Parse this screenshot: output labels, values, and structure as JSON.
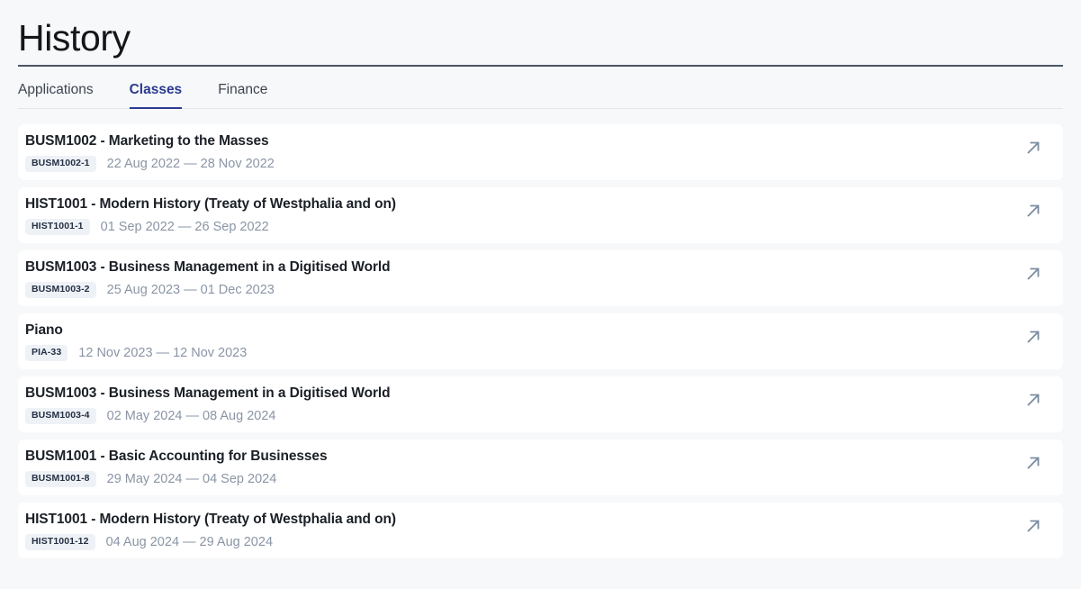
{
  "header": {
    "title": "History"
  },
  "tabs": [
    {
      "label": "Applications",
      "active": false
    },
    {
      "label": "Classes",
      "active": true
    },
    {
      "label": "Finance",
      "active": false
    }
  ],
  "icons": {
    "open_external": "arrow-up-right-icon"
  },
  "colors": {
    "page_background": "#f7f8fa",
    "card_background": "#ffffff",
    "accent": "#2b3a8f",
    "title_text": "#14161a",
    "badge_background": "#eef2f7",
    "badge_text": "#253043",
    "date_text": "#8a95a5",
    "arrow": "#7b8ca0",
    "rule": "#4a5568"
  },
  "classes": [
    {
      "title": "BUSM1002 - Marketing to the Masses",
      "code": "BUSM1002-1",
      "dates": "22 Aug 2022 — 28 Nov 2022"
    },
    {
      "title": "HIST1001 - Modern History (Treaty of Westphalia and on)",
      "code": "HIST1001-1",
      "dates": "01 Sep 2022 — 26 Sep 2022"
    },
    {
      "title": "BUSM1003 - Business Management in a Digitised World",
      "code": "BUSM1003-2",
      "dates": "25 Aug 2023 — 01 Dec 2023"
    },
    {
      "title": "Piano",
      "code": "PIA-33",
      "dates": "12 Nov 2023 — 12 Nov 2023"
    },
    {
      "title": "BUSM1003 - Business Management in a Digitised World",
      "code": "BUSM1003-4",
      "dates": "02 May 2024 — 08 Aug 2024"
    },
    {
      "title": "BUSM1001 - Basic Accounting for Businesses",
      "code": "BUSM1001-8",
      "dates": "29 May 2024 — 04 Sep 2024"
    },
    {
      "title": "HIST1001 - Modern History (Treaty of Westphalia and on)",
      "code": "HIST1001-12",
      "dates": "04 Aug 2024 — 29 Aug 2024"
    }
  ]
}
